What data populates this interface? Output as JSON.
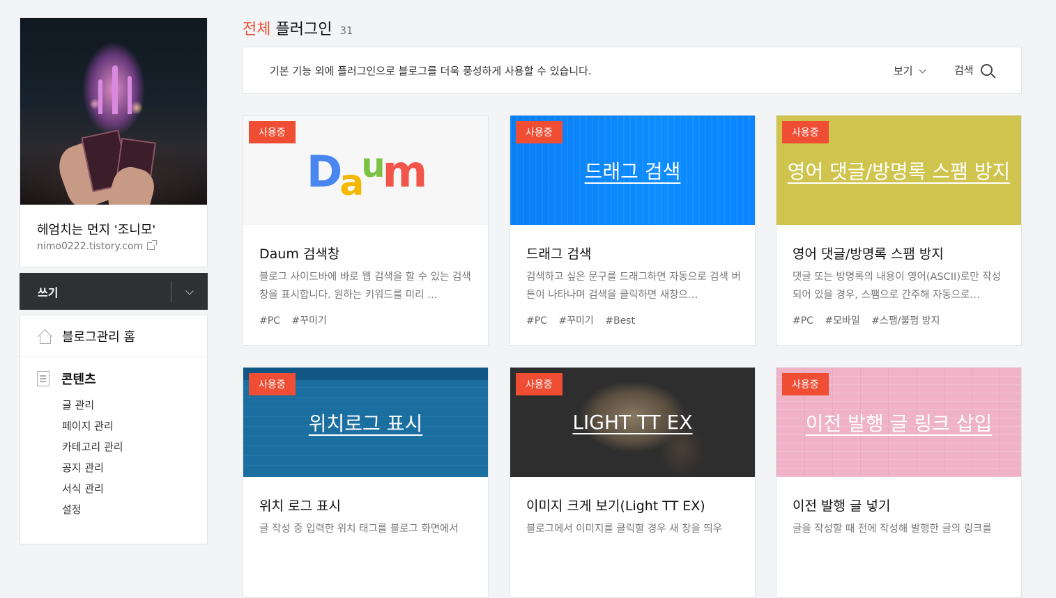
{
  "sidebar": {
    "blog_name": "헤엄치는 먼지 '조니모'",
    "blog_url": "nimo0222.tistory.com",
    "write_label": "쓰기",
    "home_label": "블로그관리 홈",
    "content_section": {
      "label": "콘텐츠",
      "items": [
        "글 관리",
        "페이지 관리",
        "카테고리 관리",
        "공지 관리",
        "서식 관리",
        "설정"
      ]
    }
  },
  "header": {
    "title_accent": "전체",
    "title_main": "플러그인",
    "count": "31"
  },
  "infobar": {
    "description": "기본 기능 외에 플러그인으로 블로그를 더욱 풍성하게 사용할 수 있습니다.",
    "view_label": "보기",
    "search_label": "검색"
  },
  "plugins": [
    {
      "badge": "사용중",
      "thumb_text": "",
      "title": "Daum 검색창",
      "description": "블로그 사이드바에 바로 웹 검색을 할 수 있는 검색창을 표시합니다. 원하는 키워드를 미리 …",
      "tags": [
        "#PC",
        "#꾸미기"
      ],
      "thumb_color": "#f7f7f8"
    },
    {
      "badge": "사용중",
      "thumb_text": "드래그 검색",
      "title": "드래그 검색",
      "description": "검색하고 싶은 문구를 드래그하면 자동으로 검색 버튼이 나타나며 검색을 클릭하면 새창으…",
      "tags": [
        "#PC",
        "#꾸미기",
        "#Best"
      ],
      "thumb_color": "#0a84ff"
    },
    {
      "badge": "사용중",
      "thumb_text": "영어 댓글/방명록 스팸 방지",
      "title": "영어 댓글/방명록 스팸 방지",
      "description": "댓글 또는 방명록의 내용이 영어(ASCII)로만 작성되어 있을 경우, 스팸으로 간주해 자동으로…",
      "tags": [
        "#PC",
        "#모바일",
        "#스팸/불펌 방지"
      ],
      "thumb_color": "#cfc54e"
    },
    {
      "badge": "사용중",
      "thumb_text": "위치로그 표시",
      "title": "위치 로그 표시",
      "description": "글 작성 중 입력한 위치 태그를 블로그 화면에서",
      "tags": [],
      "thumb_color": "#1a6fa0"
    },
    {
      "badge": "사용중",
      "thumb_text": "LIGHT TT EX",
      "title": "이미지 크게 보기(Light TT EX)",
      "description": "블로그에서 이미지를 클릭할 경우 새 창을 띄우",
      "tags": [],
      "thumb_color": "#2e2e2e"
    },
    {
      "badge": "사용중",
      "thumb_text": "이전 발행 글 링크 삽입",
      "title": "이전 발행 글 넣기",
      "description": "글을 작성할 때 전에 작성해 발행한 글의 링크를",
      "tags": [],
      "thumb_color": "#efb2c6"
    }
  ]
}
